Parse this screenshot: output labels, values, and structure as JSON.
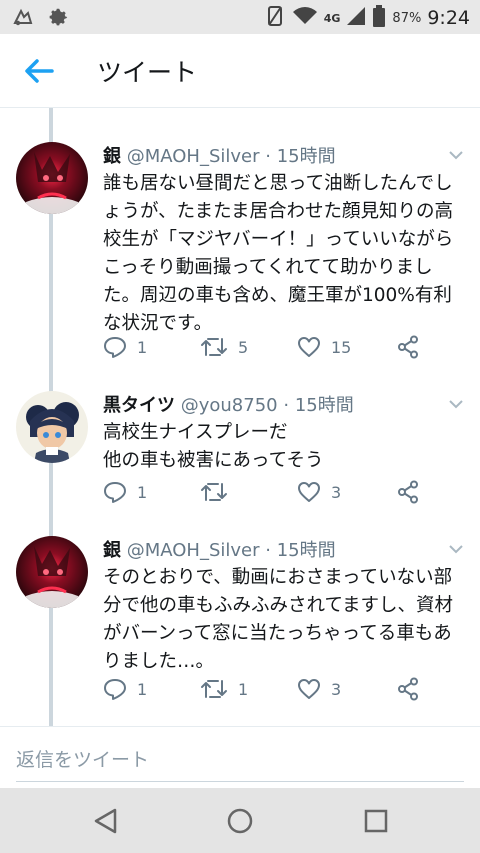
{
  "status_bar": {
    "network": "4G",
    "battery": "87%",
    "time": "9:24",
    "icons": [
      "app-notification-icon",
      "gear-icon",
      "vibrate-icon",
      "wifi-icon",
      "signal-icon",
      "battery-icon"
    ]
  },
  "header": {
    "title": "ツイート",
    "back_icon": "arrow-left-icon"
  },
  "tweets": [
    {
      "name": "銀",
      "handle": "@MAOH_Silver",
      "dot": "·",
      "time": "15時間",
      "text": "誰も居ない昼間だと思って油断したんでしょうが、たまたま居合わせた顔見知りの高校生が「マジヤバーイ！」っていいながらこっそり動画撮ってくれてて助かりました。周辺の車も含め、魔王軍が100%有利な状況です。",
      "replies": "1",
      "retweets": "5",
      "likes": "15"
    },
    {
      "name": "黒タイツ",
      "handle": "@you8750",
      "dot": "·",
      "time": "15時間",
      "text": "高校生ナイスプレーだ\n他の車も被害にあってそう",
      "replies": "1",
      "retweets": "",
      "likes": "3"
    },
    {
      "name": "銀",
      "handle": "@MAOH_Silver",
      "dot": "·",
      "time": "15時間",
      "text": "そのとおりで、動画におさまっていない部分で他の車もふみふみされてますし、資材がバーンって窓に当たっちゃってる車もありました…。",
      "replies": "1",
      "retweets": "1",
      "likes": "3"
    }
  ],
  "reply_box": {
    "placeholder": "返信をツイート"
  },
  "colors": {
    "accent": "#1da1f2",
    "muted": "#657786",
    "text": "#14171a",
    "thread": "#ccd6dd"
  }
}
